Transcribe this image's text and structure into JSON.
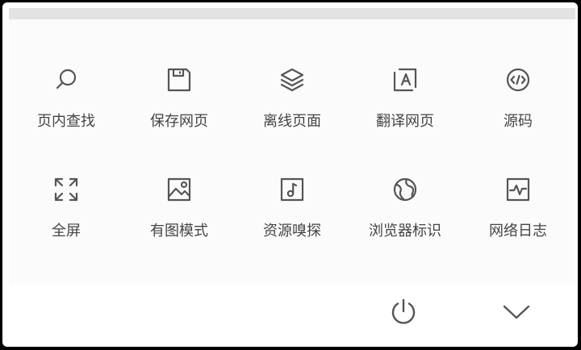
{
  "menu": {
    "row1": [
      {
        "label": "页内查找",
        "icon": "search-icon"
      },
      {
        "label": "保存网页",
        "icon": "save-icon"
      },
      {
        "label": "离线页面",
        "icon": "layers-icon"
      },
      {
        "label": "翻译网页",
        "icon": "translate-icon"
      },
      {
        "label": "源码",
        "icon": "code-icon"
      }
    ],
    "row2": [
      {
        "label": "全屏",
        "icon": "fullscreen-icon"
      },
      {
        "label": "有图模式",
        "icon": "image-icon"
      },
      {
        "label": "资源嗅探",
        "icon": "music-icon"
      },
      {
        "label": "浏览器标识",
        "icon": "globe-icon"
      },
      {
        "label": "网络日志",
        "icon": "pulse-icon"
      }
    ]
  },
  "bottom": {
    "power_icon": "power-icon",
    "collapse_icon": "chevron-down-icon"
  },
  "colors": {
    "icon": "#555555",
    "text": "#444444",
    "background": "#fbfbfb",
    "strip": "#e3e3e3"
  }
}
